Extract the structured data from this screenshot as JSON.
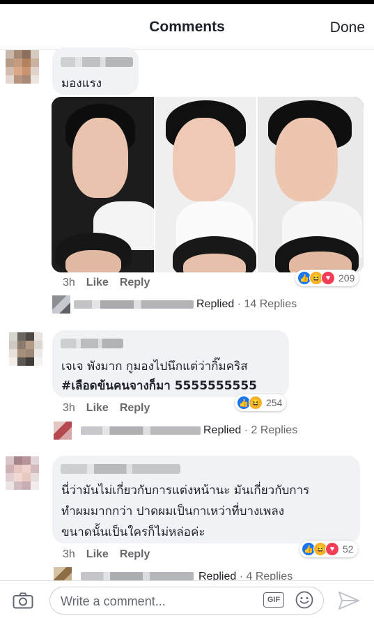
{
  "header": {
    "title": "Comments",
    "done_label": "Done"
  },
  "comments": [
    {
      "text_lines": [
        "มองแรง"
      ],
      "time": "3h",
      "like_label": "Like",
      "reply_label": "Reply",
      "reaction_count": "209",
      "replied_label": "Replied",
      "replies_label": "· 14 Replies"
    },
    {
      "text_lines": [
        "เจเจ พังมาก กูมองไปนึกแต่ว่ากิ๊มคริส",
        "#เลือดข้นคนจางก็มา 5555555555"
      ],
      "time": "3h",
      "like_label": "Like",
      "reply_label": "Reply",
      "reaction_count": "254",
      "replied_label": "Replied",
      "replies_label": "· 2 Replies"
    },
    {
      "text_lines": [
        "นี่ว่ามันไม่เกี่ยวกับการแต่งหน้านะ มันเกี่ยวกับการ",
        "ทำผมมากกว่า ปาดผมเป็นกาเหว่าที่บางเพลง",
        "ขนาดนั้นเป็นใครก็ไม่หล่อค่ะ"
      ],
      "time": "3h",
      "like_label": "Like",
      "reply_label": "Reply",
      "reaction_count": "52",
      "replied_label": "Replied",
      "replies_label": "· 4 Replies"
    }
  ],
  "composer": {
    "placeholder": "Write a comment...",
    "gif_label": "GIF"
  },
  "icons": [
    "camera-icon",
    "gif-icon",
    "emoji-icon",
    "send-icon",
    "like-reaction-icon",
    "haha-reaction-icon",
    "love-reaction-icon"
  ],
  "colors": {
    "like": "#1877f2",
    "haha": "#f7b125",
    "love": "#f33e58",
    "bubble": "#f0f2f5",
    "meta": "#65676b"
  }
}
